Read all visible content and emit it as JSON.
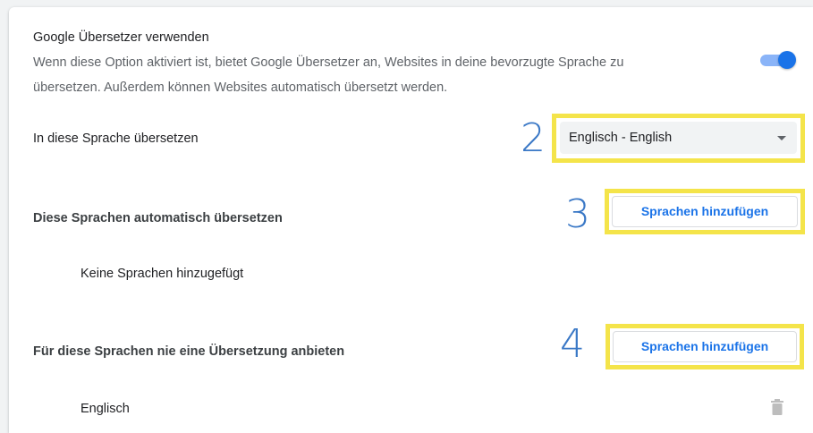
{
  "translate": {
    "title": "Google Übersetzer verwenden",
    "description_line1": "Wenn diese Option aktiviert ist, bietet Google Übersetzer an, Websites in deine bevorzugte Sprache zu",
    "description_line2": "übersetzen. Außerdem können Websites automatisch übersetzt werden.",
    "toggle_state": "on",
    "accent_color": "#1a73e8"
  },
  "target_language": {
    "label": "In diese Sprache übersetzen",
    "selected": "Englisch - English",
    "step_number": "2"
  },
  "auto_translate": {
    "label": "Diese Sprachen automatisch übersetzen",
    "add_button": "Sprachen hinzufügen",
    "step_number": "3",
    "empty_text": "Keine Sprachen hinzugefügt"
  },
  "never_translate": {
    "label": "Für diese Sprachen nie eine Übersetzung anbieten",
    "add_button": "Sprachen hinzufügen",
    "step_number": "4",
    "items": [
      {
        "name": "Englisch",
        "action_icon": "trash-icon"
      }
    ]
  },
  "highlight_color": "#f4e44a"
}
